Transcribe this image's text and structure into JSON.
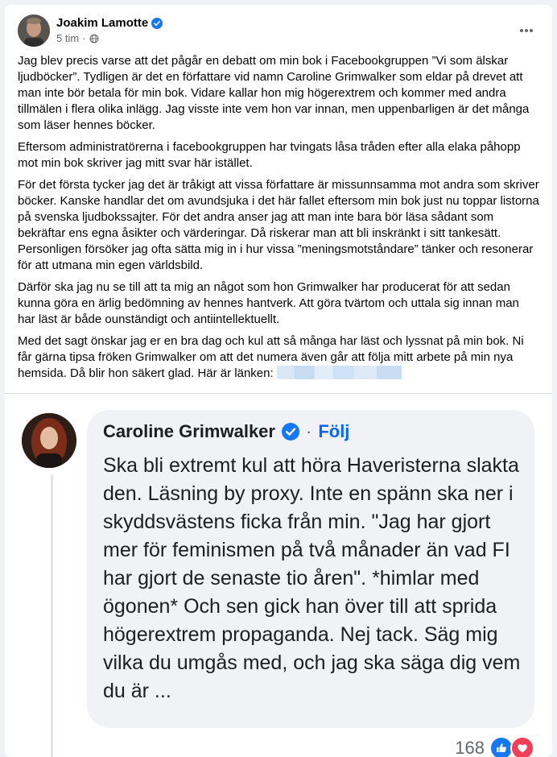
{
  "post": {
    "author": "Joakim Lamotte",
    "timestamp": "5 tim",
    "separator": "·",
    "paragraphs": [
      "Jag blev precis varse att det pågår en debatt om min bok i Facebookgruppen ”Vi som älskar ljudböcker”. Tydligen är det en författare vid namn Caroline Grimwalker som eldar på drevet att man inte bör betala för min bok. Vidare kallar hon mig högerextrem och kommer med andra tillmälen i flera olika inlägg. Jag visste inte vem hon var innan, men uppenbarligen är det många som läser hennes böcker.",
      "Eftersom administratörerna i facebookgruppen har tvingats låsa tråden efter alla elaka påhopp mot min bok skriver jag mitt svar här istället.",
      "För det första tycker jag det är tråkigt att vissa författare är missunnsamma mot andra som skriver böcker. Kanske handlar det om avundsjuka i det här fallet eftersom min bok just nu toppar listorna på svenska ljudbokssajter. För det andra anser jag att man inte bara bör läsa sådant som bekräftar ens egna åsikter och värderingar. Då riskerar man att bli inskränkt i sitt tankesätt. Personligen försöker jag ofta sätta mig in i hur vissa ”meningsmotståndare” tänker och resonerar för att utmana min egen världsbild.",
      "Därför ska jag nu se till att ta mig an något som hon Grimwalker har producerat för att sedan kunna göra en ärlig bedömning av hennes hantverk. Att göra tvärtom och uttala sig innan man har läst är både ounständigt och antiintellektuellt.",
      "Med det sagt önskar jag er en bra dag och kul att så många har läst och lyssnat på min bok. Ni får gärna tipsa fröken Grimwalker om att det numera även går att följa mitt arbete på min nya hemsida. Då blir hon säkert glad. Här är länken:"
    ]
  },
  "comment": {
    "author": "Caroline Grimwalker",
    "separator": "·",
    "follow_label": "Följ",
    "text": "Ska bli extremt kul att höra Haveristerna slakta den. Läsning by proxy. Inte en spänn ska ner i skyddsvästens ficka från min. \"Jag har gjort mer för feminismen på två månader än vad FI har gjort de senaste tio åren\". *himlar med ögonen* Och sen gick han över till att sprida högerextrem propaganda. Nej tack. Säg mig vilka du umgås med, och jag ska säga dig vem du är ...",
    "reaction_count": "168",
    "reactions": [
      "like-icon",
      "love-icon"
    ]
  },
  "colors": {
    "verified_blue": "#1877f2",
    "follow_blue": "#0866ff",
    "like_blue": "#1877f2",
    "love_red": "#f33e58",
    "page_bg": "#f0f2f5",
    "bubble_bg": "#f0f2f5"
  },
  "icons": {
    "verified": "verified-badge-icon",
    "audience": "globe-icon",
    "more": "more-options-icon"
  }
}
